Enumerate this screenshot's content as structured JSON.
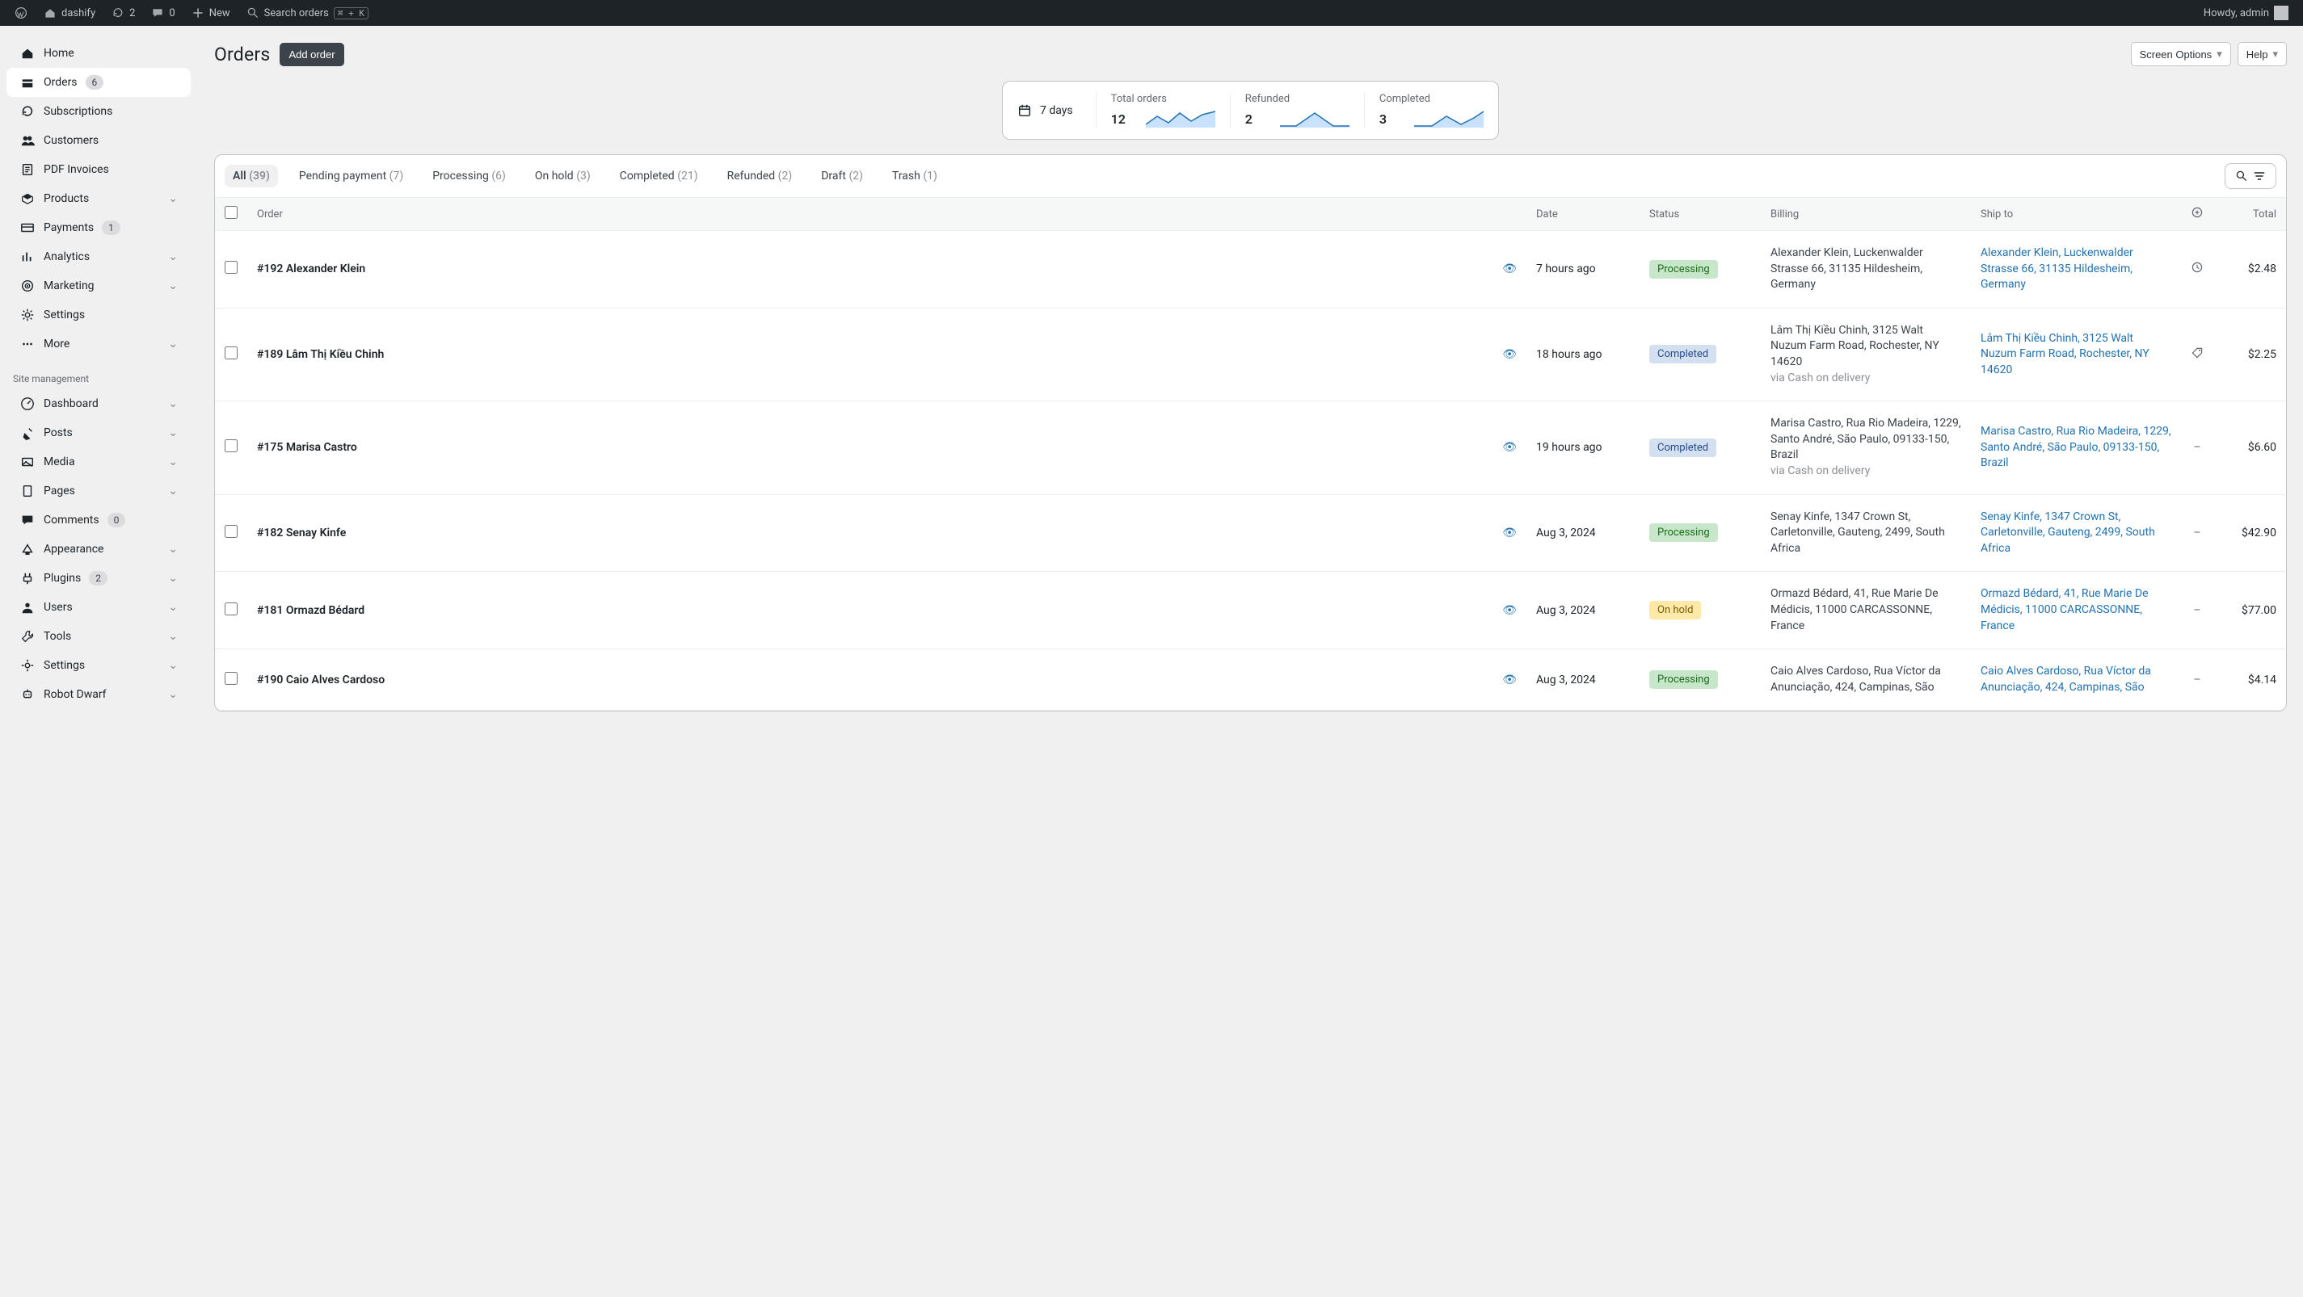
{
  "adminbar": {
    "site_name": "dashify",
    "refresh_count": "2",
    "comments_count": "0",
    "new_label": "New",
    "search_placeholder": "Search orders",
    "search_kbd": "⌘ + K",
    "howdy": "Howdy, admin"
  },
  "sidebar": {
    "items": [
      {
        "key": "home",
        "label": "Home"
      },
      {
        "key": "orders",
        "label": "Orders",
        "badge": "6",
        "active": true
      },
      {
        "key": "subscriptions",
        "label": "Subscriptions"
      },
      {
        "key": "customers",
        "label": "Customers"
      },
      {
        "key": "pdf",
        "label": "PDF Invoices"
      },
      {
        "key": "products",
        "label": "Products",
        "expandable": true
      },
      {
        "key": "payments",
        "label": "Payments",
        "badge": "1"
      },
      {
        "key": "analytics",
        "label": "Analytics",
        "expandable": true
      },
      {
        "key": "marketing",
        "label": "Marketing",
        "expandable": true
      },
      {
        "key": "settings",
        "label": "Settings"
      },
      {
        "key": "more",
        "label": "More",
        "expandable": true
      }
    ],
    "section_label": "Site management",
    "site_items": [
      {
        "key": "dashboard",
        "label": "Dashboard",
        "expandable": true
      },
      {
        "key": "posts",
        "label": "Posts",
        "expandable": true
      },
      {
        "key": "media",
        "label": "Media",
        "expandable": true
      },
      {
        "key": "pages",
        "label": "Pages",
        "expandable": true
      },
      {
        "key": "comments",
        "label": "Comments",
        "badge": "0"
      },
      {
        "key": "appearance",
        "label": "Appearance",
        "expandable": true
      },
      {
        "key": "plugins",
        "label": "Plugins",
        "badge": "2",
        "expandable": true
      },
      {
        "key": "users",
        "label": "Users",
        "expandable": true
      },
      {
        "key": "tools",
        "label": "Tools",
        "expandable": true
      },
      {
        "key": "wp_settings",
        "label": "Settings",
        "expandable": true
      },
      {
        "key": "robot",
        "label": "Robot Dwarf",
        "expandable": true
      }
    ]
  },
  "page": {
    "title": "Orders",
    "add_label": "Add order",
    "screen_options": "Screen Options",
    "help": "Help"
  },
  "summary": {
    "period": "7 days",
    "metrics": {
      "total": {
        "label": "Total orders",
        "value": "12"
      },
      "refunded": {
        "label": "Refunded",
        "value": "2"
      },
      "completed": {
        "label": "Completed",
        "value": "3"
      }
    }
  },
  "tabs": [
    {
      "key": "all",
      "label": "All",
      "count": "(39)",
      "active": true
    },
    {
      "key": "pending",
      "label": "Pending payment",
      "count": "(7)"
    },
    {
      "key": "processing",
      "label": "Processing",
      "count": "(6)"
    },
    {
      "key": "onhold",
      "label": "On hold",
      "count": "(3)"
    },
    {
      "key": "completed",
      "label": "Completed",
      "count": "(21)"
    },
    {
      "key": "refunded",
      "label": "Refunded",
      "count": "(2)"
    },
    {
      "key": "draft",
      "label": "Draft",
      "count": "(2)"
    },
    {
      "key": "trash",
      "label": "Trash",
      "count": "(1)"
    }
  ],
  "columns": {
    "order": "Order",
    "date": "Date",
    "status": "Status",
    "billing": "Billing",
    "shipto": "Ship to",
    "total": "Total"
  },
  "rows": [
    {
      "order": "#192 Alexander Klein",
      "date": "7 hours ago",
      "status": "Processing",
      "status_class": "st-processing",
      "billing": "Alexander Klein, Luckenwalder Strasse 66, 31135 Hildesheim, Germany",
      "via": "",
      "ship": "Alexander Klein, Luckenwalder Strasse 66, 31135 Hildesheim, Germany",
      "shipicon": "history",
      "total": "$2.48"
    },
    {
      "order": "#189 Lâm Thị Kiều Chinh",
      "date": "18 hours ago",
      "status": "Completed",
      "status_class": "st-completed",
      "billing": "Lâm Thị Kiều Chinh, 3125 Walt Nuzum Farm Road, Rochester, NY 14620",
      "via": "via Cash on delivery",
      "ship": "Lâm Thị Kiều Chinh, 3125 Walt Nuzum Farm Road, Rochester, NY 14620",
      "shipicon": "tag",
      "total": "$2.25"
    },
    {
      "order": "#175 Marisa Castro",
      "date": "19 hours ago",
      "status": "Completed",
      "status_class": "st-completed",
      "billing": "Marisa Castro, Rua Rio Madeira, 1229, Santo André, São Paulo, 09133-150, Brazil",
      "via": "via Cash on delivery",
      "ship": "Marisa Castro, Rua Rio Madeira, 1229, Santo André, São Paulo, 09133-150, Brazil",
      "shipicon": "dash",
      "total": "$6.60"
    },
    {
      "order": "#182 Senay Kinfe",
      "date": "Aug 3, 2024",
      "status": "Processing",
      "status_class": "st-processing",
      "billing": "Senay Kinfe, 1347 Crown St, Carletonville, Gauteng, 2499, South Africa",
      "via": "",
      "ship": "Senay Kinfe, 1347 Crown St, Carletonville, Gauteng, 2499, South Africa",
      "shipicon": "dash",
      "total": "$42.90"
    },
    {
      "order": "#181 Ormazd Bédard",
      "date": "Aug 3, 2024",
      "status": "On hold",
      "status_class": "st-onhold",
      "billing": "Ormazd Bédard, 41, Rue Marie De Médicis, 11000 CARCASSONNE, France",
      "via": "",
      "ship": "Ormazd Bédard, 41, Rue Marie De Médicis, 11000 CARCASSONNE, France",
      "shipicon": "dash",
      "total": "$77.00"
    },
    {
      "order": "#190 Caio Alves Cardoso",
      "date": "Aug 3, 2024",
      "status": "Processing",
      "status_class": "st-processing",
      "billing": "Caio Alves Cardoso, Rua Víctor da Anunciação, 424, Campinas, São",
      "via": "",
      "ship": "Caio Alves Cardoso, Rua Víctor da Anunciação, 424, Campinas, São",
      "shipicon": "dash",
      "total": "$4.14"
    }
  ],
  "icons": {
    "dash": "–"
  }
}
